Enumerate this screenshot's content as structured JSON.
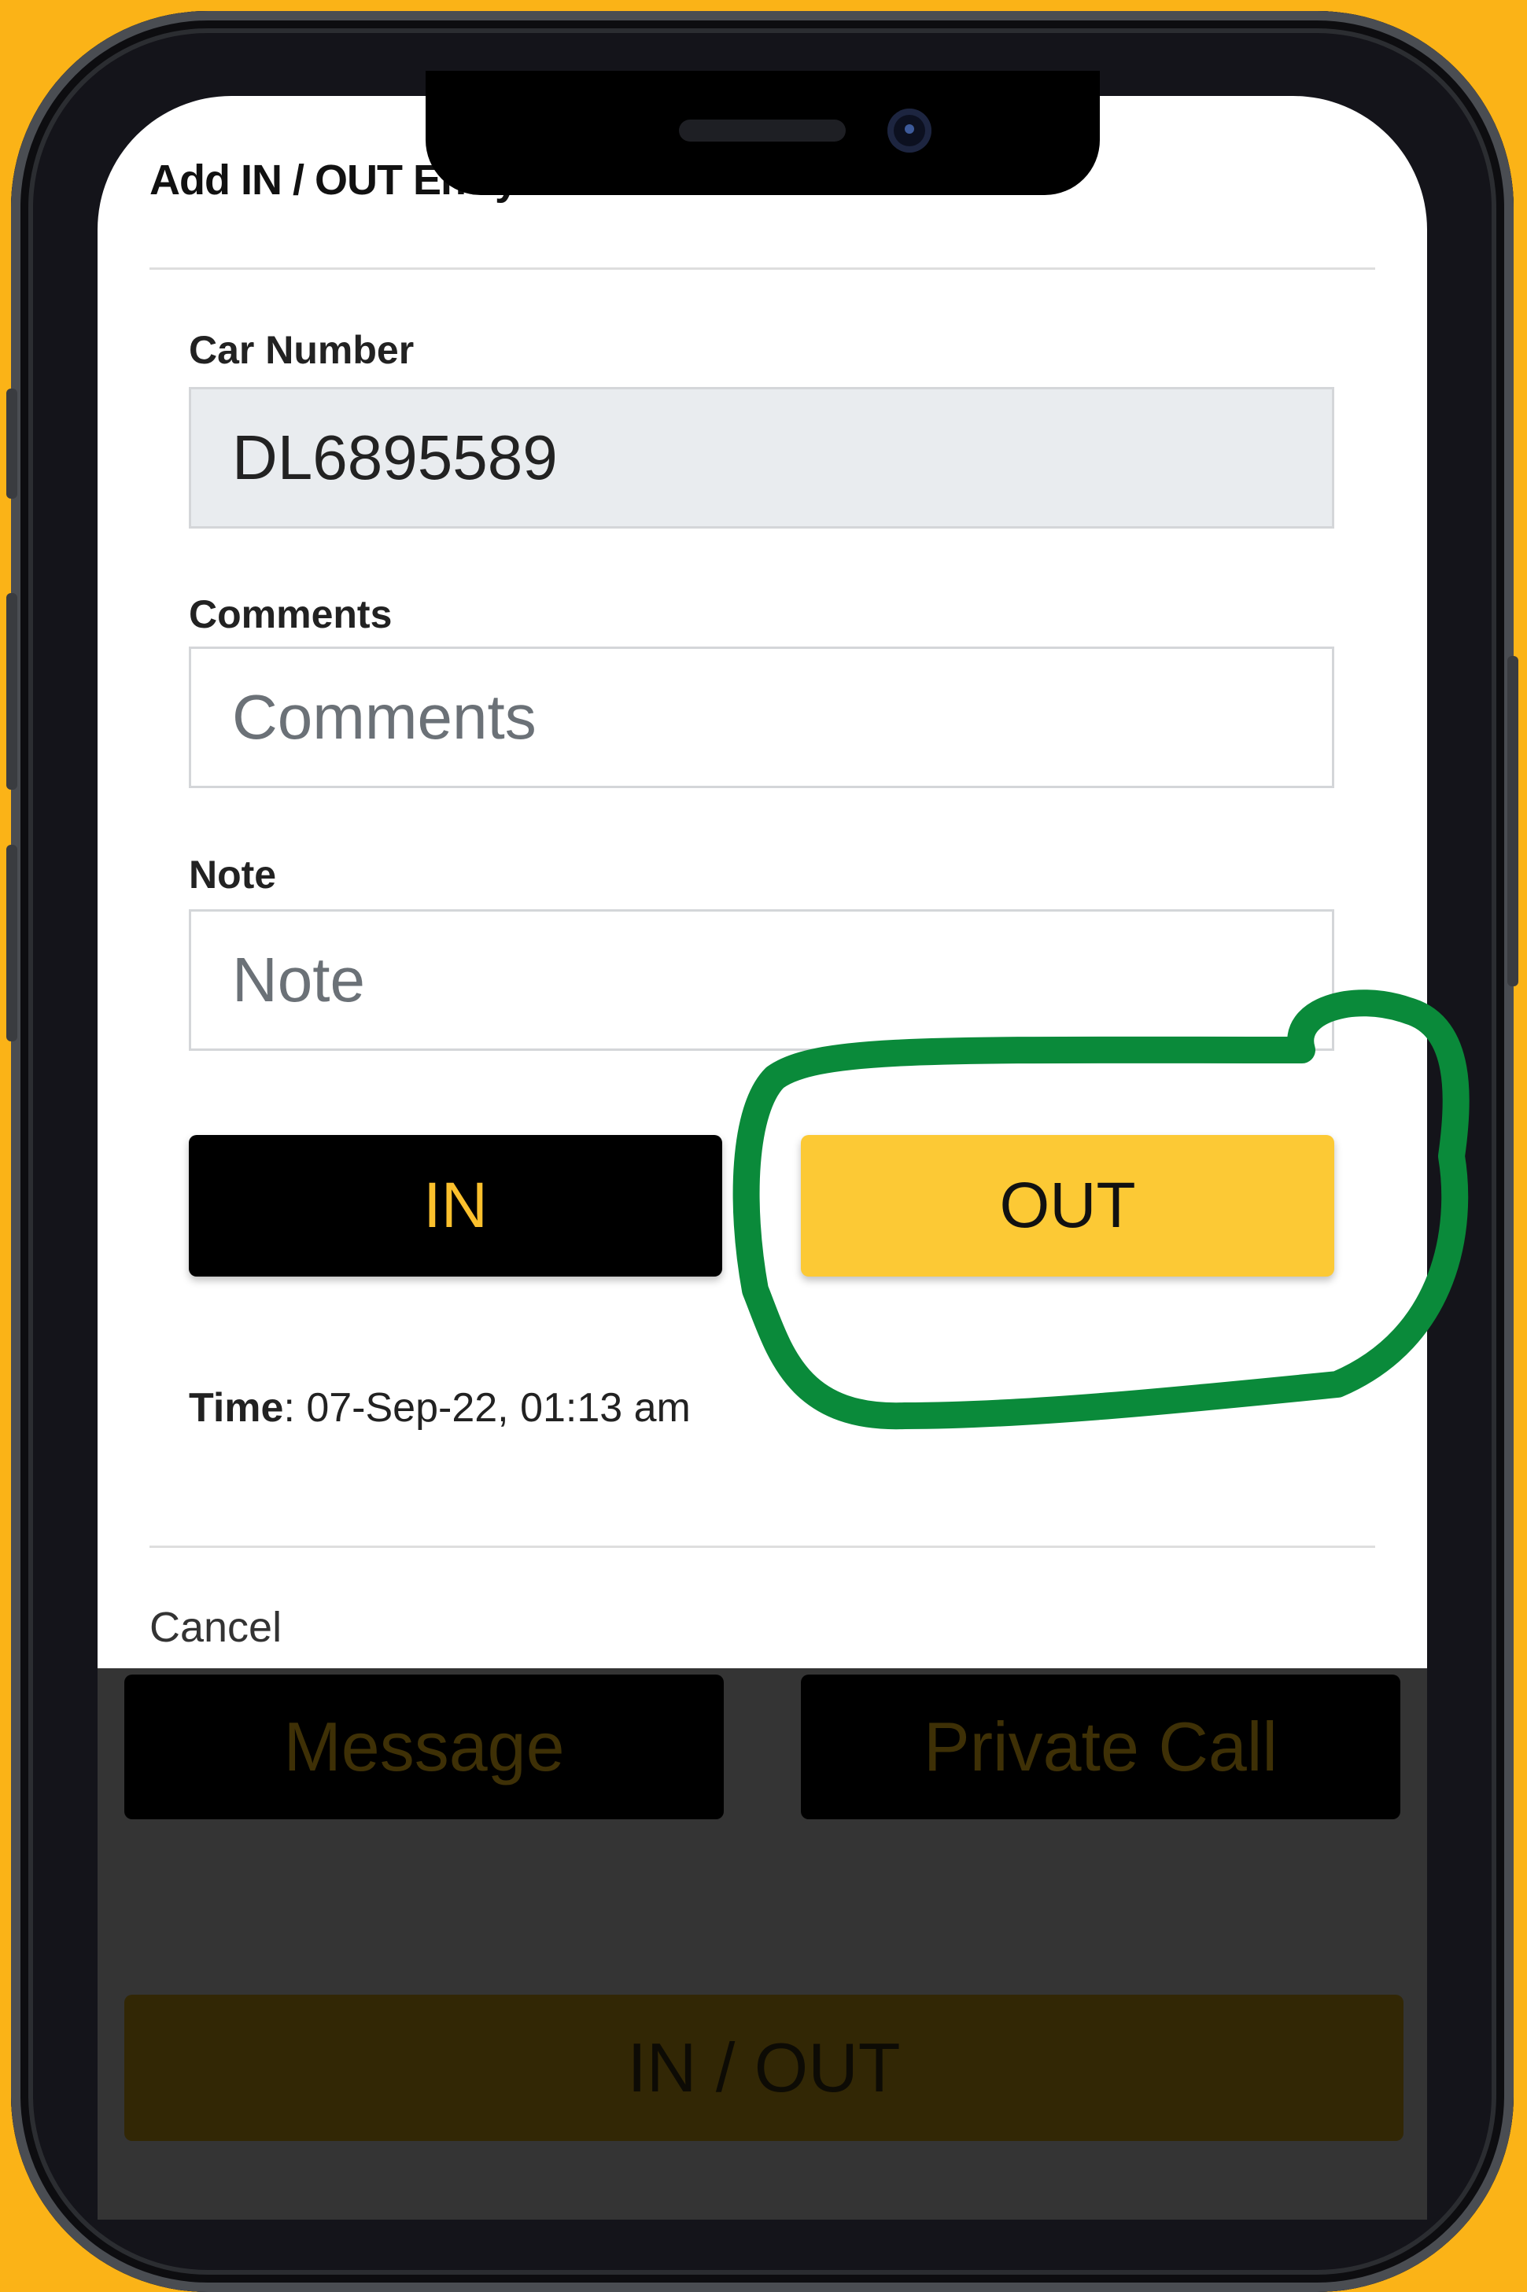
{
  "dialog": {
    "title": "Add IN / OUT Entry:",
    "car_number": {
      "label": "Car Number",
      "value": "DL6895589"
    },
    "comments": {
      "label": "Comments",
      "placeholder": "Comments"
    },
    "note": {
      "label": "Note",
      "placeholder": "Note"
    },
    "in_button": "IN",
    "out_button": "OUT",
    "time": {
      "label": "Time",
      "value": ": 07-Sep-22, 01:13 am"
    },
    "cancel": "Cancel"
  },
  "background": {
    "message_button": "Message",
    "private_call_button": "Private Call",
    "in_out_button": "IN / OUT"
  },
  "colors": {
    "page_background": "#fbb317",
    "accent_yellow": "#fcc935",
    "highlight_marker": "#0a8a3a"
  }
}
